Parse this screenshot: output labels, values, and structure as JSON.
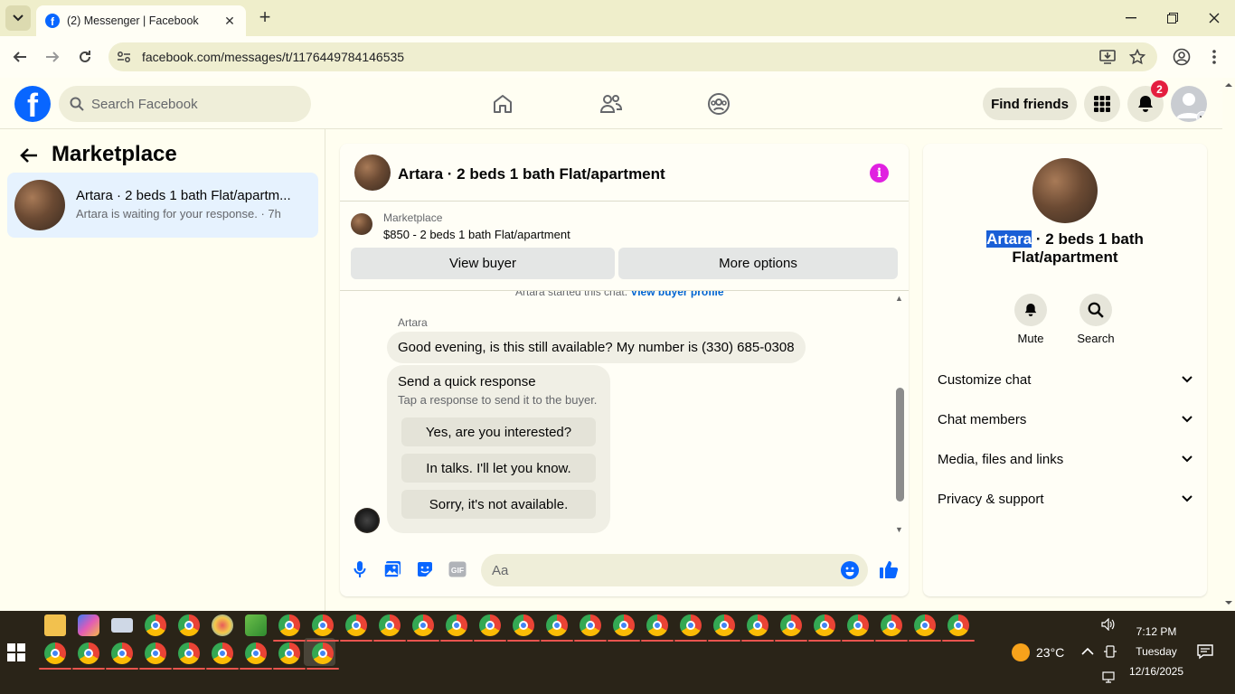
{
  "browser": {
    "tab_title": "(2) Messenger | Facebook",
    "tab_favicon": "f",
    "url": "facebook.com/messages/t/1176449784146535"
  },
  "fb": {
    "logo": "f",
    "search_placeholder": "Search Facebook",
    "find_friends": "Find friends",
    "notifications_count": "2"
  },
  "left": {
    "title": "Marketplace",
    "conversation": {
      "title": "Artara · 2 beds 1 bath Flat/apartm...",
      "subtitle": "Artara is waiting for your response. · 7h"
    }
  },
  "chat": {
    "header_title": "Artara · 2 beds 1 bath Flat/apartment",
    "info_glyph": "i",
    "marketplace_label": "Marketplace",
    "listing": "$850 - 2 beds 1 bath Flat/apartment",
    "view_buyer": "View buyer",
    "more_options": "More options",
    "started_text": "Artara started this chat.",
    "view_buyer_profile": "View buyer profile",
    "sender": "Artara",
    "message": "Good evening, is this still available? My number is (330) 685-0308",
    "quick_response": {
      "title": "Send a quick response",
      "subtitle": "Tap a response to send it to the buyer.",
      "options": [
        "Yes, are you interested?",
        "In talks. I'll let you know.",
        "Sorry, it's not available."
      ]
    },
    "composer_placeholder": "Aa",
    "gif_label": "GIF",
    "scroll_position": 0.62
  },
  "right": {
    "name_highlight": "Artara",
    "name_rest": " · 2 beds 1 bath Flat/apartment",
    "actions": [
      "Mute",
      "Search"
    ],
    "sections": [
      "Customize chat",
      "Chat members",
      "Media, files and links",
      "Privacy & support"
    ]
  },
  "taskbar": {
    "temperature": "23°C",
    "time": "7:12 PM",
    "day": "Tuesday",
    "date": "12/16/2025"
  },
  "colors": {
    "fb_blue": "#0866ff",
    "selected_conversation": "#e6f2fe",
    "notification_badge": "#e41e3f",
    "messenger_accent": "#e021e0",
    "text_highlight": "#1a5fd6"
  }
}
